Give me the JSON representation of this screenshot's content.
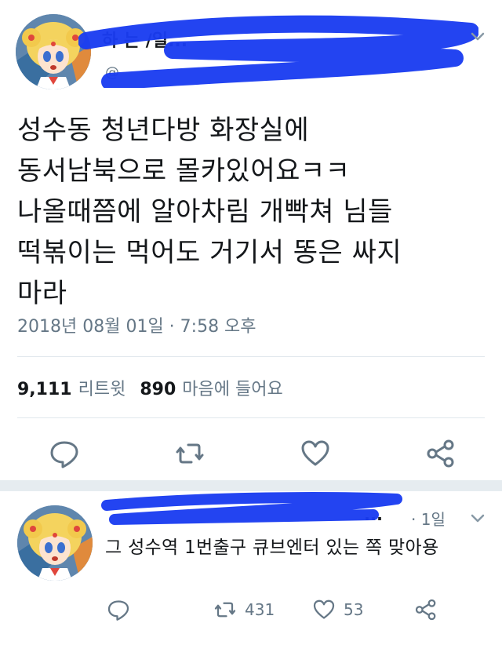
{
  "tweet": {
    "author_name_visible": "하 는 /일...",
    "author_handle_visible": "@",
    "text": "성수동 청년다방 화장실에\n동서남북으로 몰카있어요ㅋㅋ\n나올때쯤에 알아차림 개빡쳐 님들\n떡볶이는 먹어도 거기서 똥은 싸지\n마라",
    "timestamp": "2018년 08월 01일 · 7:58 오후",
    "retweet_count": "9,111",
    "retweet_label": "리트윗",
    "like_count": "890",
    "like_label": "마음에 들어요"
  },
  "reply": {
    "author_name_visible": "...",
    "time": "· 1일",
    "text": "그 성수역 1번출구 큐브엔터 있는 쪽 맞아용",
    "retweet_count": "431",
    "like_count": "53"
  },
  "colors": {
    "text": "#14171a",
    "secondary": "#657786",
    "divider": "#e1e8ed",
    "redaction": "#1a3cf0"
  },
  "icons": [
    "reply-icon",
    "retweet-icon",
    "heart-icon",
    "share-icon",
    "chevron-down-icon"
  ]
}
